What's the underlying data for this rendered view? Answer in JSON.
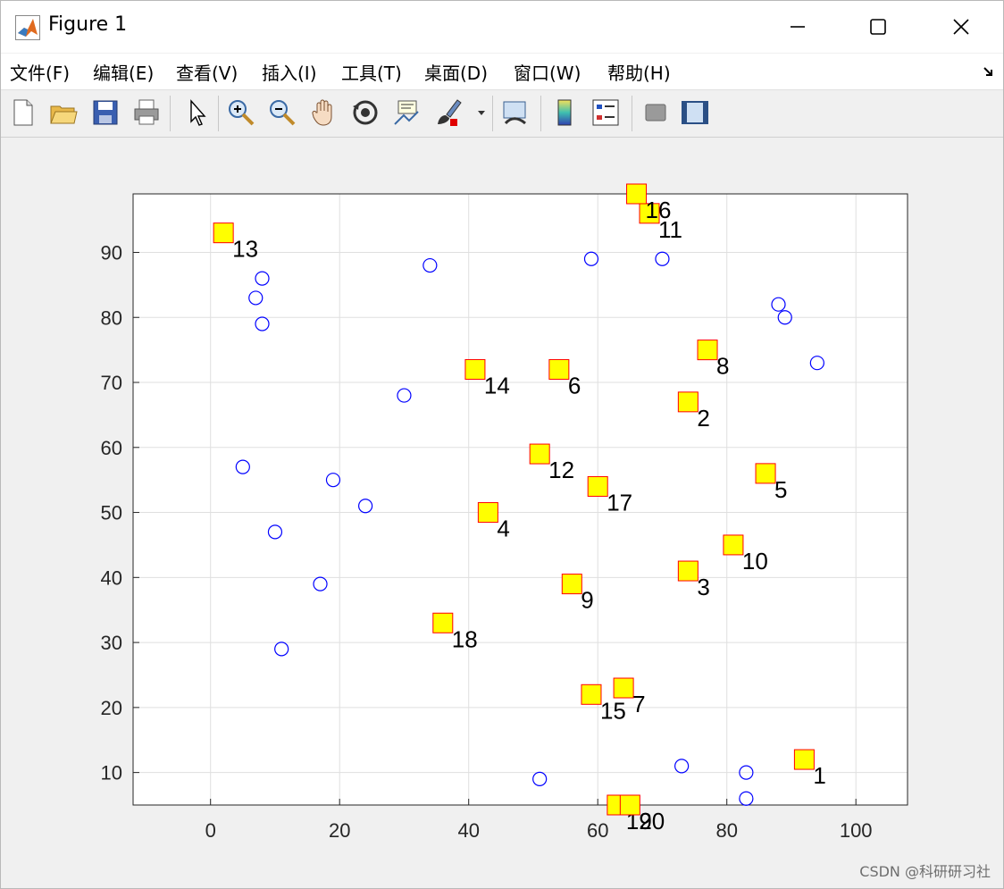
{
  "window": {
    "title": "Figure 1",
    "minimize_label": "—",
    "maximize_label": "☐",
    "close_label": "✕"
  },
  "menu": [
    "文件(F)",
    "编辑(E)",
    "查看(V)",
    "插入(I)",
    "工具(T)",
    "桌面(D)",
    "窗口(W)",
    "帮助(H)"
  ],
  "toolbar": [
    {
      "name": "new-figure-icon"
    },
    {
      "name": "open-file-icon"
    },
    {
      "name": "save-icon"
    },
    {
      "name": "print-icon"
    },
    {
      "name": "edit-pointer-icon"
    },
    {
      "name": "zoom-in-icon"
    },
    {
      "name": "zoom-out-icon"
    },
    {
      "name": "pan-hand-icon"
    },
    {
      "name": "rotate-3d-icon"
    },
    {
      "name": "data-cursor-icon"
    },
    {
      "name": "brush-icon"
    },
    {
      "name": "link-plot-icon"
    },
    {
      "name": "colorbar-icon"
    },
    {
      "name": "legend-icon"
    },
    {
      "name": "hide-plot-tools-icon"
    },
    {
      "name": "show-plot-tools-icon"
    }
  ],
  "watermark": "CSDN @科研研习社",
  "colors": {
    "marker_fill": "#ffff00",
    "marker_edge": "#ff0000",
    "circle_edge": "#0000ff",
    "grid": "#dfdfdf"
  },
  "chart_data": {
    "type": "scatter",
    "title": "",
    "xlabel": "",
    "ylabel": "",
    "xlim": [
      -12,
      108
    ],
    "ylim": [
      5,
      99
    ],
    "xticks": [
      0,
      20,
      40,
      60,
      80,
      100
    ],
    "yticks": [
      10,
      20,
      30,
      40,
      50,
      60,
      70,
      80,
      90
    ],
    "grid": true,
    "series": [
      {
        "marker": "square",
        "points": [
          {
            "x": 92,
            "y": 12,
            "label": "1"
          },
          {
            "x": 74,
            "y": 67,
            "label": "2"
          },
          {
            "x": 74,
            "y": 41,
            "label": "3"
          },
          {
            "x": 43,
            "y": 50,
            "label": "4"
          },
          {
            "x": 86,
            "y": 56,
            "label": "5"
          },
          {
            "x": 54,
            "y": 72,
            "label": "6"
          },
          {
            "x": 64,
            "y": 23,
            "label": "7"
          },
          {
            "x": 77,
            "y": 75,
            "label": "8"
          },
          {
            "x": 56,
            "y": 39,
            "label": "9"
          },
          {
            "x": 81,
            "y": 45,
            "label": "10"
          },
          {
            "x": 68,
            "y": 96,
            "label": "11"
          },
          {
            "x": 51,
            "y": 59,
            "label": "12"
          },
          {
            "x": 2,
            "y": 93,
            "label": "13"
          },
          {
            "x": 41,
            "y": 72,
            "label": "14"
          },
          {
            "x": 59,
            "y": 22,
            "label": "15"
          },
          {
            "x": 66,
            "y": 99,
            "label": "16"
          },
          {
            "x": 60,
            "y": 54,
            "label": "17"
          },
          {
            "x": 36,
            "y": 33,
            "label": "18"
          },
          {
            "x": 63,
            "y": 5,
            "label": "19"
          },
          {
            "x": 65,
            "y": 5,
            "label": "20"
          }
        ]
      },
      {
        "marker": "circle",
        "points": [
          {
            "x": 8,
            "y": 86
          },
          {
            "x": 7,
            "y": 83
          },
          {
            "x": 8,
            "y": 79
          },
          {
            "x": 34,
            "y": 88
          },
          {
            "x": 59,
            "y": 89
          },
          {
            "x": 70,
            "y": 89
          },
          {
            "x": 88,
            "y": 82
          },
          {
            "x": 89,
            "y": 80
          },
          {
            "x": 94,
            "y": 73
          },
          {
            "x": 30,
            "y": 68
          },
          {
            "x": 5,
            "y": 57
          },
          {
            "x": 19,
            "y": 55
          },
          {
            "x": 24,
            "y": 51
          },
          {
            "x": 10,
            "y": 47
          },
          {
            "x": 17,
            "y": 39
          },
          {
            "x": 11,
            "y": 29
          },
          {
            "x": 51,
            "y": 9
          },
          {
            "x": 73,
            "y": 11
          },
          {
            "x": 83,
            "y": 10
          },
          {
            "x": 83,
            "y": 6
          }
        ]
      }
    ]
  }
}
